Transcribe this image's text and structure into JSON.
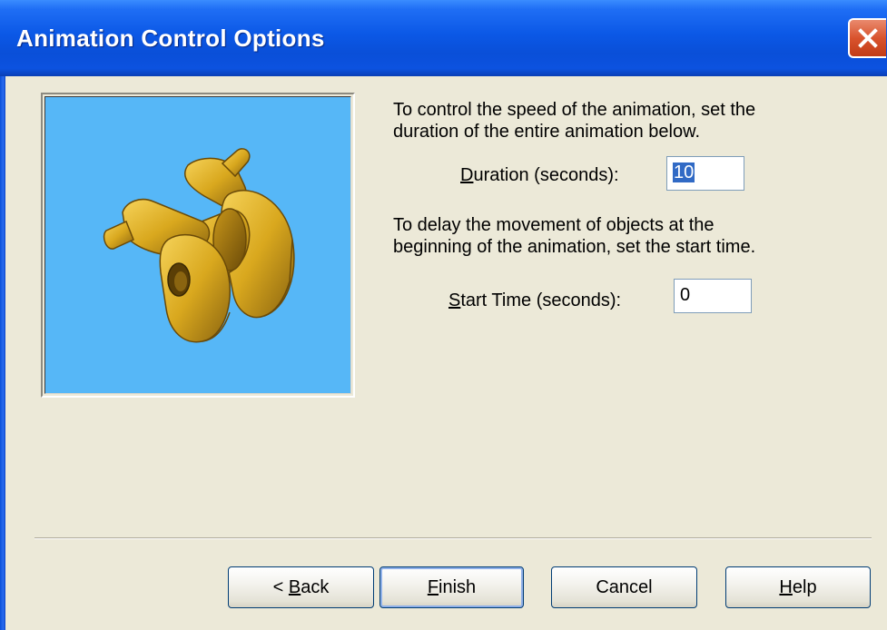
{
  "window": {
    "title": "Animation Control Options",
    "title_color": "#ffffff",
    "titlebar_color": "#0a4fd8",
    "close_icon": "close-icon"
  },
  "preview": {
    "background": "#56b7f7",
    "image": "yellow-mechanical-part-3d-model"
  },
  "intro_duration": {
    "line1": "To control the speed of the animation, set the",
    "line2": "duration of the entire animation below."
  },
  "duration": {
    "label_mnemonic": "D",
    "label_rest": "uration (seconds):",
    "value": "10"
  },
  "intro_start": {
    "line1": "To delay the movement of objects at the",
    "line2": "beginning of the animation, set the start time."
  },
  "start_time": {
    "label_mnemonic": "S",
    "label_rest": "tart Time (seconds):",
    "value": "0"
  },
  "buttons": {
    "back_prefix": "< ",
    "back_mnemonic": "B",
    "back_rest": "ack",
    "finish_mnemonic": "F",
    "finish_rest": "inish",
    "cancel": "Cancel",
    "help_mnemonic": "H",
    "help_rest": "elp"
  }
}
